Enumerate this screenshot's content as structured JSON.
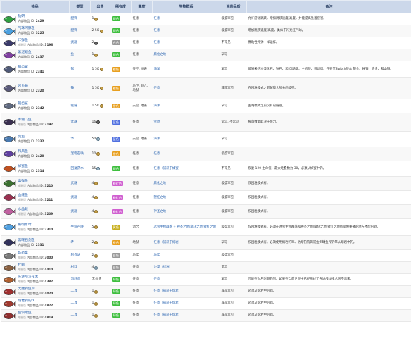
{
  "header": {
    "cols": [
      "物品",
      "类型",
      "出售",
      "稀有度",
      "高度",
      "生物群系",
      "渔获品质",
      "备注"
    ]
  },
  "colors": {
    "header_bg": "#ccd8ea",
    "header_text": "#243a5e",
    "link": "#2a64b0",
    "rarity_green": "#3fbf3f",
    "rarity_orange": "#e8a020",
    "rarity_pink": "#d060d0",
    "rarity_purple": "#9050d0",
    "rarity_yellow": "#c8b020",
    "rarity_lime": "#70b010",
    "rarity_red": "#d04040",
    "rarity_blue": "#5070e0"
  },
  "rows": [
    {
      "icon": "green-coiled-fish-icon",
      "iconColor": "#2fa040",
      "name": "钻研",
      "tag": "",
      "idLabel": "内部物品 ID:",
      "id": "2429",
      "type": "配饰",
      "sell": "1",
      "coin": "gold",
      "rarity": "绿色",
      "rarityKey": "rarity_green",
      "height": "任意",
      "biome": "任意",
      "quality": "极度罕见",
      "note": "允许游动跳跃，增加跳跃速度/高度，并能提高坠落伤害。"
    },
    {
      "icon": "balloon-fish-icon",
      "iconColor": "#4aa0e0",
      "name": "气球河豚鱼",
      "tag": "",
      "idLabel": "内部物品 ID:",
      "id": "3225",
      "type": "配饰",
      "sell": "2 50",
      "coin": "gold",
      "rarity": "绿色",
      "rarityKey": "rarity_green",
      "height": "任意",
      "biome": "任意",
      "quality": "极度罕见",
      "note": "增加跳跃速度/高度，类似于闪亮红气球。"
    },
    {
      "icon": "bomb-fish-icon",
      "iconColor": "#3a3a6a",
      "name": "炸弹鱼",
      "tag": "电脑版",
      "idLabel": "内部物品 ID:",
      "id": "3196",
      "type": "武器",
      "sell": "2",
      "coin": "copper",
      "rarity": "白色",
      "rarityKey": "rarity_white",
      "height": "任意",
      "biome": "任意",
      "quality": "不常见",
      "note": "像粘性炸弹一样运作。"
    },
    {
      "icon": "purple-worm-icon",
      "iconColor": "#8040a0",
      "name": "紫泥鳗鱼",
      "tag": "",
      "idLabel": "内部物品 ID:",
      "id": "2437",
      "type": "鱼",
      "sell": "1",
      "coin": "gold",
      "rarity": "绿色",
      "rarityKey": "rarity_green",
      "height": "任意",
      "biome": "腐化之地",
      "quality": "罕见",
      "note": ""
    },
    {
      "icon": "shark-fish-icon",
      "iconColor": "#505a78",
      "name": "锯齿鲨",
      "tag": "",
      "idLabel": "内部物品 ID:",
      "id": "2341",
      "type": "锯",
      "sell": "1 50",
      "coin": "gold",
      "rarity": "橙色",
      "rarityKey": "rarity_orange",
      "height": "天空, 地表",
      "biome": "海洋",
      "quality": "罕见",
      "note": "能够采挖沙漠化石、钴石、和 电脑版、主机版、移动版、任天堂Switch版本 钯金、秘银、铂金、和山铜。"
    },
    {
      "icon": "rock-fish-icon",
      "iconColor": "#5a5a7a",
      "name": "岩鱼锤",
      "tag": "",
      "idLabel": "内部物品 ID:",
      "id": "2320",
      "type": "锤",
      "sell": "1 50",
      "coin": "gold",
      "rarity": "橙色",
      "rarityKey": "rarity_orange",
      "height": "地下, 洞穴, 地狱",
      "biome": "任意",
      "quality": "非常罕见",
      "note": "在困难模式之前解锁大部分的墙壁。"
    },
    {
      "icon": "saw-fish-icon",
      "iconColor": "#606a80",
      "name": "锯齿鲨",
      "tag": "",
      "idLabel": "内部物品 ID:",
      "id": "2342",
      "type": "锯链",
      "sell": "1 50",
      "coin": "gold",
      "rarity": "橙色",
      "rarityKey": "rarity_orange",
      "height": "天空, 地表",
      "biome": "海洋",
      "quality": "罕见",
      "note": "困难模式之前仅有的链锯。"
    },
    {
      "icon": "frost-daggerfish-icon",
      "iconColor": "#3a3050",
      "name": "寒霜飞鱼",
      "tag": "电脑版",
      "idLabel": "内部物品 ID:",
      "id": "3197",
      "type": "武器",
      "sell": "16",
      "coin": "copper",
      "rarity": "蓝色",
      "rarityKey": "rarity_blue",
      "height": "任意",
      "biome": "雪原",
      "quality": "常见, 不常见",
      "note": "掉落数量取决于渔力。"
    },
    {
      "icon": "swordfish-icon",
      "iconColor": "#4a7ab0",
      "name": "剑鱼",
      "tag": "",
      "idLabel": "内部物品 ID:",
      "id": "2332",
      "type": "矛",
      "sell": "50",
      "coin": "silver",
      "rarity": "蓝色",
      "rarityKey": "rarity_blue",
      "height": "天空, 地表",
      "biome": "海洋",
      "quality": "罕见",
      "note": ""
    },
    {
      "icon": "zephyr-fish-icon",
      "iconColor": "#6040a0",
      "name": "和风鱼",
      "tag": "",
      "idLabel": "内部物品 ID:",
      "id": "2420",
      "type": "宠物召唤",
      "sell": "10",
      "coin": "gold",
      "rarity": "橙色",
      "rarityKey": "rarity_orange",
      "height": "任意",
      "biome": "任意",
      "quality": "极度罕见",
      "note": ""
    },
    {
      "icon": "honeyfin-icon",
      "iconColor": "#c05020",
      "name": "蜂蜜鱼",
      "tag": "",
      "idLabel": "内部物品 ID:",
      "id": "2314",
      "type": "回复药水",
      "sell": "15",
      "coin": "silver",
      "rarity": "绿色",
      "rarityKey": "rarity_green",
      "height": "任意",
      "biome": "任意（捕获于蜂蜜）",
      "quality": "不常见",
      "note": "恢复 120 生命值，最大堆叠数为 30，必须从蜂蜜中钓。"
    },
    {
      "icon": "toxikarp-icon",
      "iconColor": "#3a7030",
      "name": "毒弹鱼",
      "tag": "电脑版",
      "idLabel": "内部物品 ID:",
      "id": "3210",
      "type": "武器",
      "sell": "4",
      "coin": "gold",
      "rarity": "粉红色",
      "rarityKey": "rarity_pink",
      "height": "任意",
      "biome": "腐化之地",
      "quality": "极度罕见",
      "note": "仅困难模式有。"
    },
    {
      "icon": "bladetongue-icon",
      "iconColor": "#9a3050",
      "name": "血缝鱼",
      "tag": "电脑版",
      "idLabel": "内部物品 ID:",
      "id": "3211",
      "type": "武器",
      "sell": "4",
      "coin": "gold",
      "rarity": "粉红色",
      "rarityKey": "rarity_pink",
      "height": "任意",
      "biome": "猩红之地",
      "quality": "极度罕见",
      "note": "仅困难模式有。"
    },
    {
      "icon": "crystal-serpent-icon",
      "iconColor": "#c060a0",
      "name": "水晶蛇",
      "tag": "电脑版",
      "idLabel": "内部物品 ID:",
      "id": "3209",
      "type": "武器",
      "sell": "4",
      "coin": "gold",
      "rarity": "粉红色",
      "rarityKey": "rarity_pink",
      "height": "任意",
      "biome": "神圣之地",
      "quality": "极度罕见",
      "note": "仅困难模式有。"
    },
    {
      "icon": "jellyfish-icon",
      "iconColor": "#50a0e0",
      "name": "照明水母",
      "tag": "电脑版",
      "idLabel": "内部物品 ID:",
      "id": "2310",
      "type": "坐骑召唤",
      "sell": "5",
      "coin": "gold",
      "rarity": "黄色",
      "rarityKey": "rarity_yellow",
      "height": "洞穴",
      "biome": "冰雪生物群落 + 神圣之地/腐化之地/猩红之地",
      "quality": "极度罕见",
      "note": "仅困难模式有。必须在冰雪生物群落和神圣之地/腐化之地/猩红之地所提供重叠的地方才能钓到。"
    },
    {
      "icon": "obsidian-swordfish-icon",
      "iconColor": "#30305a",
      "name": "黑曜石剑鱼",
      "tag": "",
      "idLabel": "内部物品 ID:",
      "id": "2331",
      "type": "矛",
      "sell": "2",
      "coin": "gold",
      "rarity": "橙色",
      "rarityKey": "rarity_orange",
      "height": "地狱",
      "biome": "任意（捕获于熔岩）",
      "quality": "罕见",
      "note": "仅困难模式有。必须使用熔岩钓竿、防熔钓钩饵或鱼饵罐鱼作钓竿从熔岩中钓。"
    },
    {
      "icon": "alchemy-table-icon",
      "iconColor": "#7a7a7a",
      "name": "炼药桌",
      "tag": "电脑版",
      "idLabel": "内部物品 ID:",
      "id": "3000",
      "type": "制作站",
      "sell": "2",
      "coin": "gold",
      "rarity": "白色",
      "rarityKey": "rarity_white",
      "height": "地牢",
      "biome": "地牢",
      "quality": "极度罕见",
      "note": ""
    },
    {
      "icon": "oyster-icon",
      "iconColor": "#8a6040",
      "name": "牡蛎",
      "tag": "电脑版",
      "idLabel": "内部物品 ID:",
      "id": "4410",
      "type": "材料",
      "sell": "4",
      "coin": "silver",
      "rarity": "白色",
      "rarityKey": "rarity_white",
      "height": "任意",
      "biome": "沙漠（绿洲）",
      "quality": "常见",
      "note": ""
    },
    {
      "icon": "combat-book-icon",
      "iconColor": "#b06030",
      "name": "先进战斗技术",
      "tag": "电脑版",
      "idLabel": "内部物品 ID:",
      "id": "4382",
      "type": "消耗品",
      "sell": "无价值",
      "coin": "none",
      "rarity": "绿色",
      "rarityKey": "rarity_green",
      "height": "任意",
      "biome": "任意",
      "quality": "罕见",
      "note": "只能在血月时期钓到。如果在当前世界中已经用过了先进战斗技术则不出来。"
    },
    {
      "icon": "dreadful-rod-icon",
      "iconColor": "#a03030",
      "name": "无魔钓鱼钩",
      "tag": "电脑版",
      "idLabel": "内部物品 ID:",
      "id": "4020",
      "type": "工具",
      "sell": "1",
      "coin": "gold",
      "rarity": "绿色",
      "rarityKey": "rarity_green",
      "height": "任意",
      "biome": "任意（捕获于熔岩）",
      "quality": "非常罕见",
      "note": "必须从熔岩中钓到。"
    },
    {
      "icon": "lava-fishing-hook-icon",
      "iconColor": "#a03a30",
      "name": "熔岩钓钩饵",
      "tag": "电脑版",
      "idLabel": "内部物品 ID:",
      "id": "4872",
      "type": "工具",
      "sell": "1",
      "coin": "gold",
      "rarity": "绿色",
      "rarityKey": "rarity_green",
      "height": "任意",
      "biome": "任意（捕获于熔岩）",
      "quality": "非常罕见",
      "note": "必须从熔岩中钓到。"
    },
    {
      "icon": "bait-pot-icon",
      "iconColor": "#903030",
      "name": "鱼饵罐鱼",
      "tag": "电脑版",
      "idLabel": "内部物品 ID:",
      "id": "4819",
      "type": "工具",
      "sell": "1",
      "coin": "gold",
      "rarity": "绿色",
      "rarityKey": "rarity_green",
      "height": "任意",
      "biome": "任意（捕获于熔岩）",
      "quality": "非常罕见",
      "note": "必须从熔岩中钓到。"
    }
  ]
}
